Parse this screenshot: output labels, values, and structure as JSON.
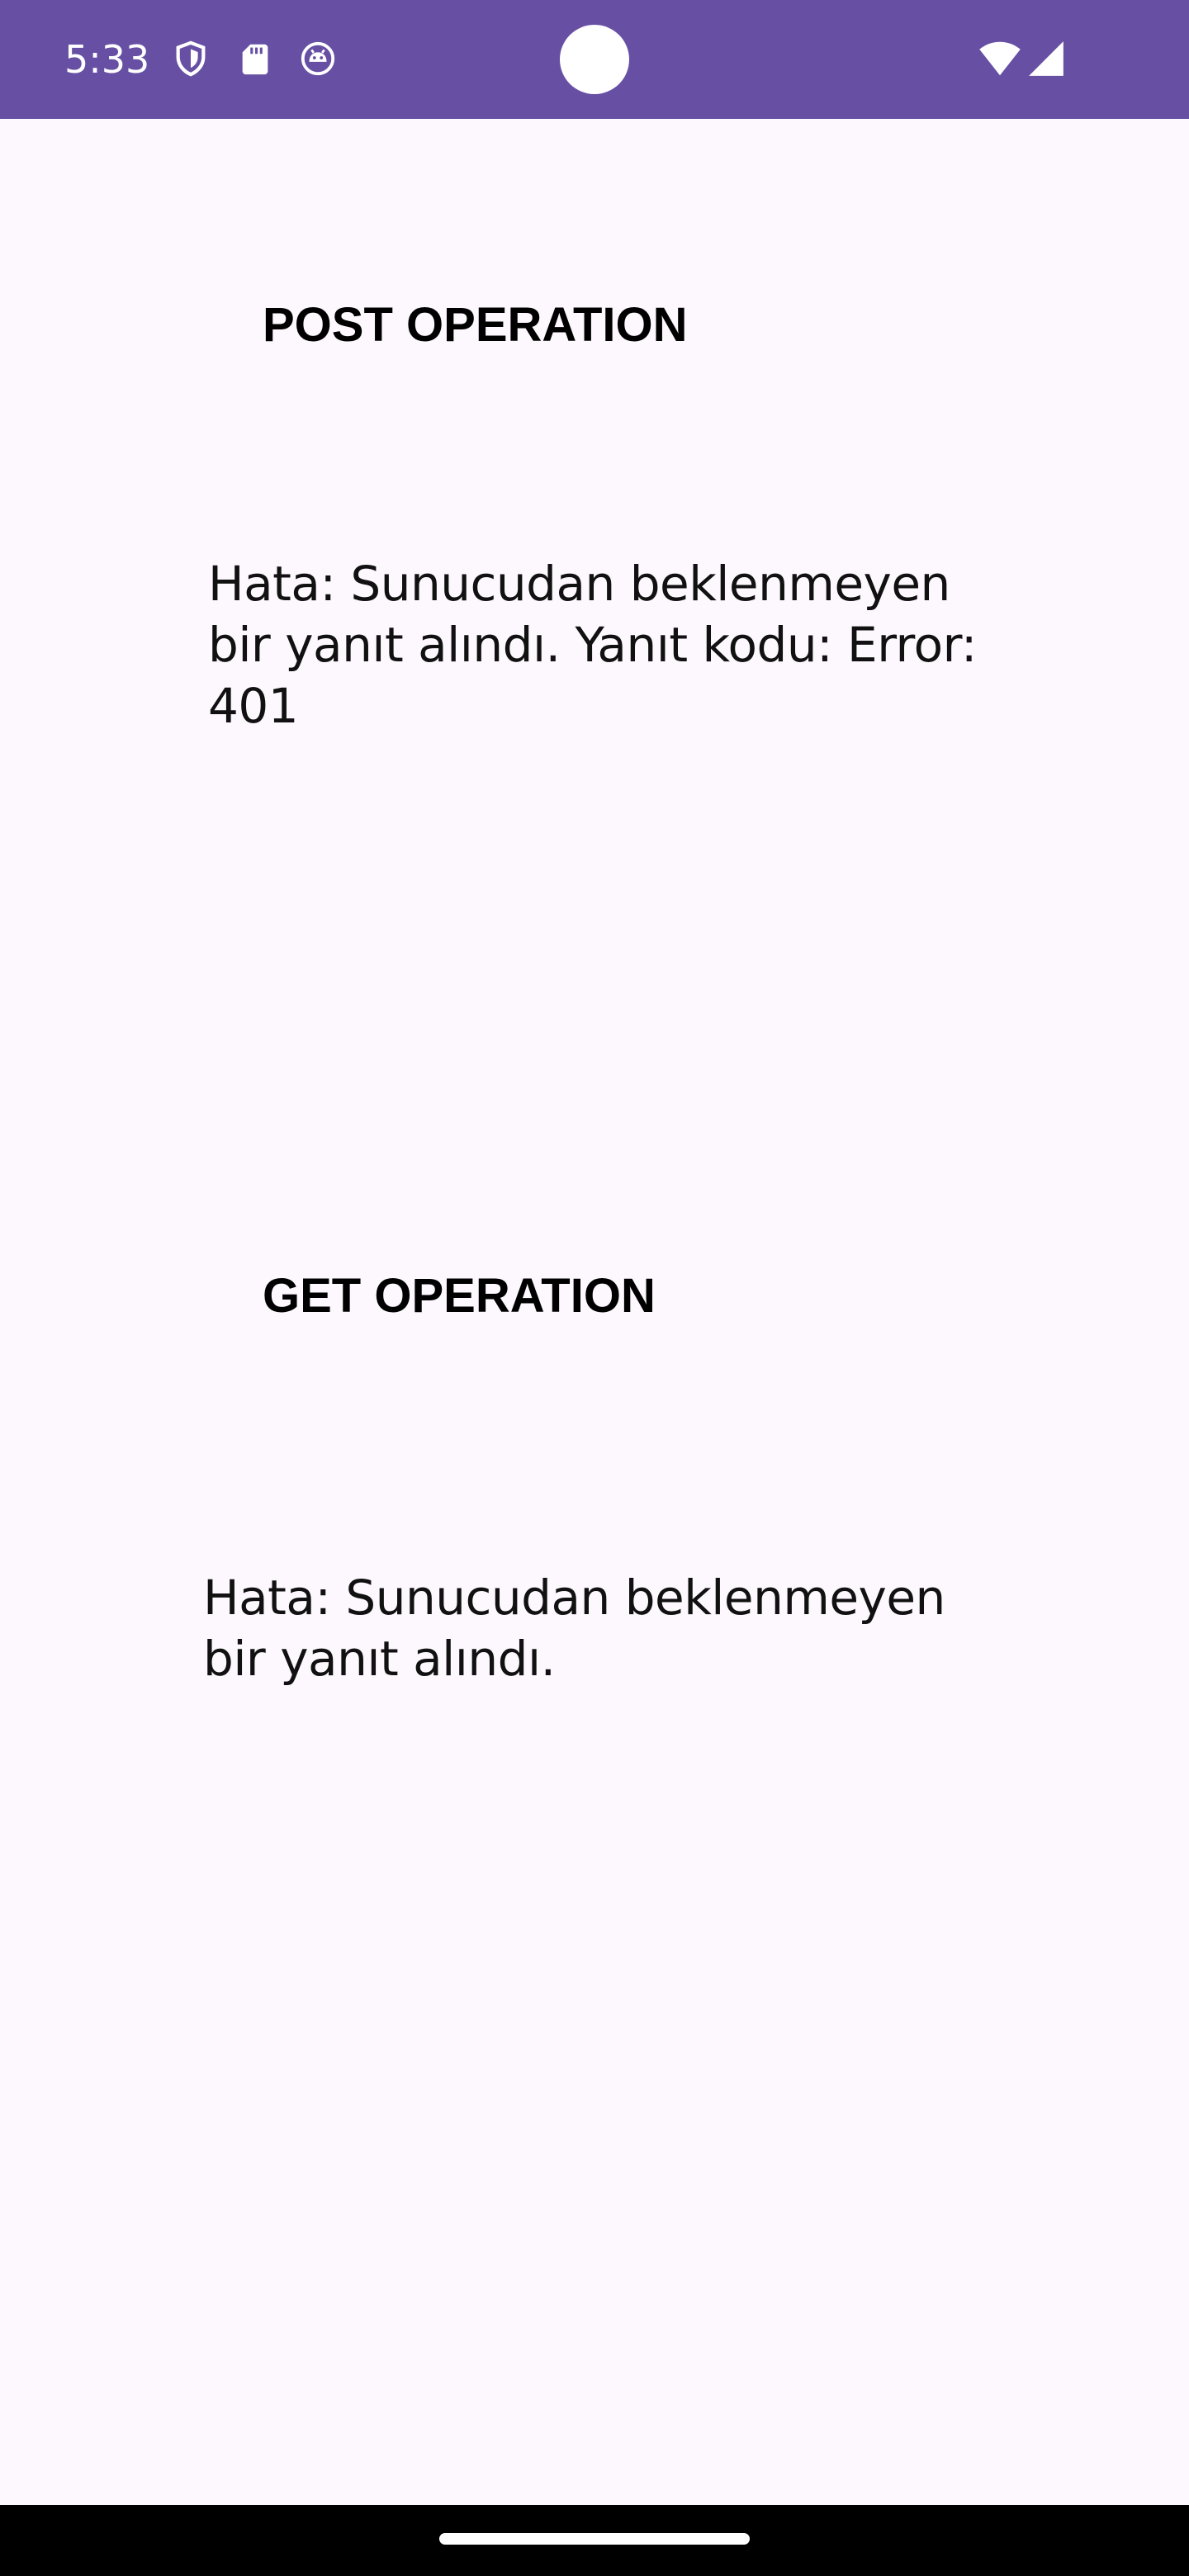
{
  "status_bar": {
    "time": "5:33",
    "background_color": "#6750a4",
    "icons": {
      "shield": "shield-icon",
      "sd_card": "sd-card-icon",
      "bug": "android-debug-icon",
      "wifi": "wifi-icon",
      "signal": "cellular-signal-icon"
    }
  },
  "post_section": {
    "title": "POST OPERATION",
    "message": "Hata: Sunucudan beklenmeyen\nbir yanıt alındı. Yanıt kodu: Error:\n401"
  },
  "get_section": {
    "title": "GET OPERATION",
    "message": "Hata: Sunucudan beklenmeyen\nbir yanıt alındı."
  },
  "theme": {
    "background": "#fdf7fe",
    "nav_bar": "#000000"
  }
}
